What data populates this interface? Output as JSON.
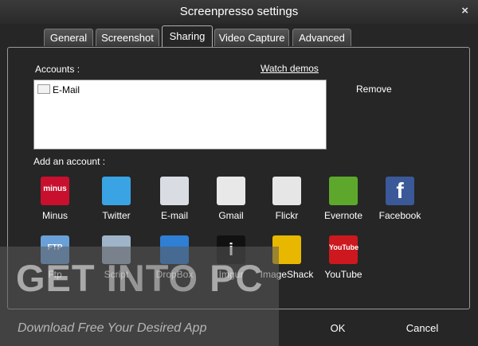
{
  "window": {
    "title": "Screenpresso settings",
    "close_glyph": "×"
  },
  "tabs": [
    {
      "label": "General",
      "active": false
    },
    {
      "label": "Screenshot",
      "active": false
    },
    {
      "label": "Sharing",
      "active": true
    },
    {
      "label": "Video Capture",
      "active": false
    },
    {
      "label": "Advanced",
      "active": false
    }
  ],
  "sharing": {
    "accounts_label": "Accounts :",
    "watch_demos": "Watch demos",
    "remove": "Remove",
    "accounts": [
      {
        "name": "E-Mail",
        "icon": "email-icon"
      }
    ],
    "add_label": "Add an account :",
    "services": [
      {
        "name": "Minus",
        "icon": "minus-icon",
        "color": "#c8102e",
        "icon_text": "minus"
      },
      {
        "name": "Twitter",
        "icon": "twitter-bird-icon",
        "color": "#3aa3e3"
      },
      {
        "name": "E-mail",
        "icon": "envelope-icon",
        "color": "#d9dde3"
      },
      {
        "name": "Gmail",
        "icon": "gmail-icon",
        "color": "#e8e8e8"
      },
      {
        "name": "Flickr",
        "icon": "flickr-icon",
        "color": "#e6e6e6"
      },
      {
        "name": "Evernote",
        "icon": "evernote-icon",
        "color": "#5da82c"
      },
      {
        "name": "Facebook",
        "icon": "facebook-icon",
        "color": "#3b5998",
        "icon_text": "f"
      },
      {
        "name": "Ftp",
        "icon": "ftp-folder-icon",
        "color": "#6aa0d8",
        "icon_text": "FTP"
      },
      {
        "name": "Script",
        "icon": "script-scroll-icon",
        "color": "#9fb4c9"
      },
      {
        "name": "DropBox",
        "icon": "dropbox-icon",
        "color": "#2f7fd4"
      },
      {
        "name": "Imgur",
        "icon": "imgur-icon",
        "color": "#111111",
        "icon_text": "i"
      },
      {
        "name": "ImageShack",
        "icon": "imageshack-frog-icon",
        "color": "#e8b800"
      },
      {
        "name": "YouTube",
        "icon": "youtube-icon",
        "color": "#cc181e",
        "icon_text": "YouTube"
      }
    ]
  },
  "buttons": {
    "ok": "OK",
    "cancel": "Cancel"
  },
  "watermark": {
    "get": "GET",
    "into": "INTO",
    "pc": "PC",
    "tagline": "Download Free Your Desired App"
  }
}
